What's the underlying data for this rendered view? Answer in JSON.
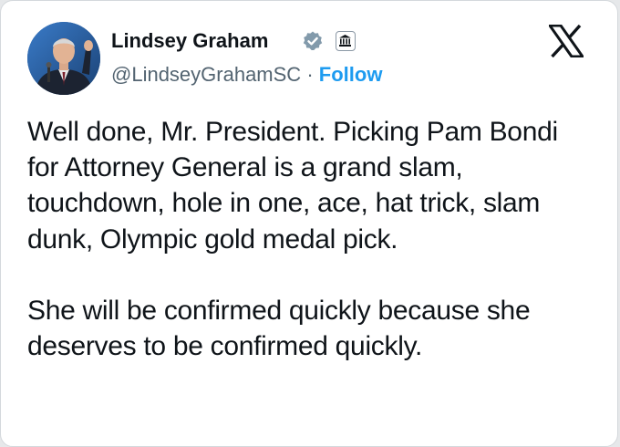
{
  "author": {
    "display_name": "Lindsey Graham",
    "handle": "@LindseyGrahamSC",
    "separator": "·",
    "follow_label": "Follow",
    "verified_icon": "verified-badge-icon",
    "affiliation_icon": "government-building-icon",
    "verified_color": "#829aab"
  },
  "platform": {
    "logo_icon": "x-logo-icon"
  },
  "tweet": {
    "paragraphs": [
      "Well done, Mr. President. Picking Pam Bondi for Attorney General is a grand slam, touchdown, hole in one, ace, hat trick, slam dunk, Olympic gold medal pick.",
      "She will be confirmed quickly because she deserves to be confirmed quickly."
    ]
  },
  "colors": {
    "text": "#0f1419",
    "secondary": "#536471",
    "link": "#1d9bf0",
    "background": "#ffffff"
  }
}
